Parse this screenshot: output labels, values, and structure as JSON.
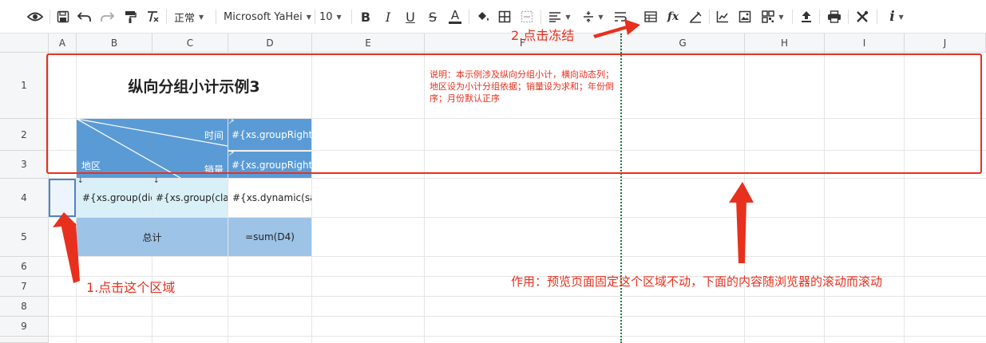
{
  "toolbar": {
    "font_style": "正常",
    "font_name": "Microsoft YaHei",
    "font_size": "10",
    "fx_label": "fx",
    "info_label": "i"
  },
  "columns": [
    "A",
    "B",
    "C",
    "D",
    "E",
    "F",
    "G",
    "H",
    "I",
    "J"
  ],
  "rows": [
    "1",
    "2",
    "3",
    "4",
    "5",
    "6",
    "7",
    "8",
    "9"
  ],
  "cells": {
    "title": "纵向分组小计示例3",
    "description": "说明：本示例涉及纵向分组小计，横向动态列；地区设为小计分组依据；销量设为求和；年份倒序；月份默认正序",
    "header_time": "时间",
    "header_sales": "销量",
    "header_region": "地区",
    "d2": "#{xs.groupRight",
    "d3": "#{xs.groupRight",
    "b4": "#{xs.group(diq",
    "c4": "#{xs.group(clas",
    "d4": "#{xs.dynamic(sal",
    "total_label": "总计",
    "d5": "=sum(D4)"
  },
  "annotations": {
    "step1": "1.点击这个区域",
    "step2": "2.点击冻结",
    "effect": "作用：预览页面固定这个区域不动，下面的内容随浏览器的滚动而滚动"
  },
  "colors": {
    "header_blue": "#5b9bd5",
    "group_cyan": "#d9f0f8",
    "total_blue": "#9dc3e6",
    "annotation_red": "#e8301e",
    "freeze_line": "#1e7b34"
  }
}
